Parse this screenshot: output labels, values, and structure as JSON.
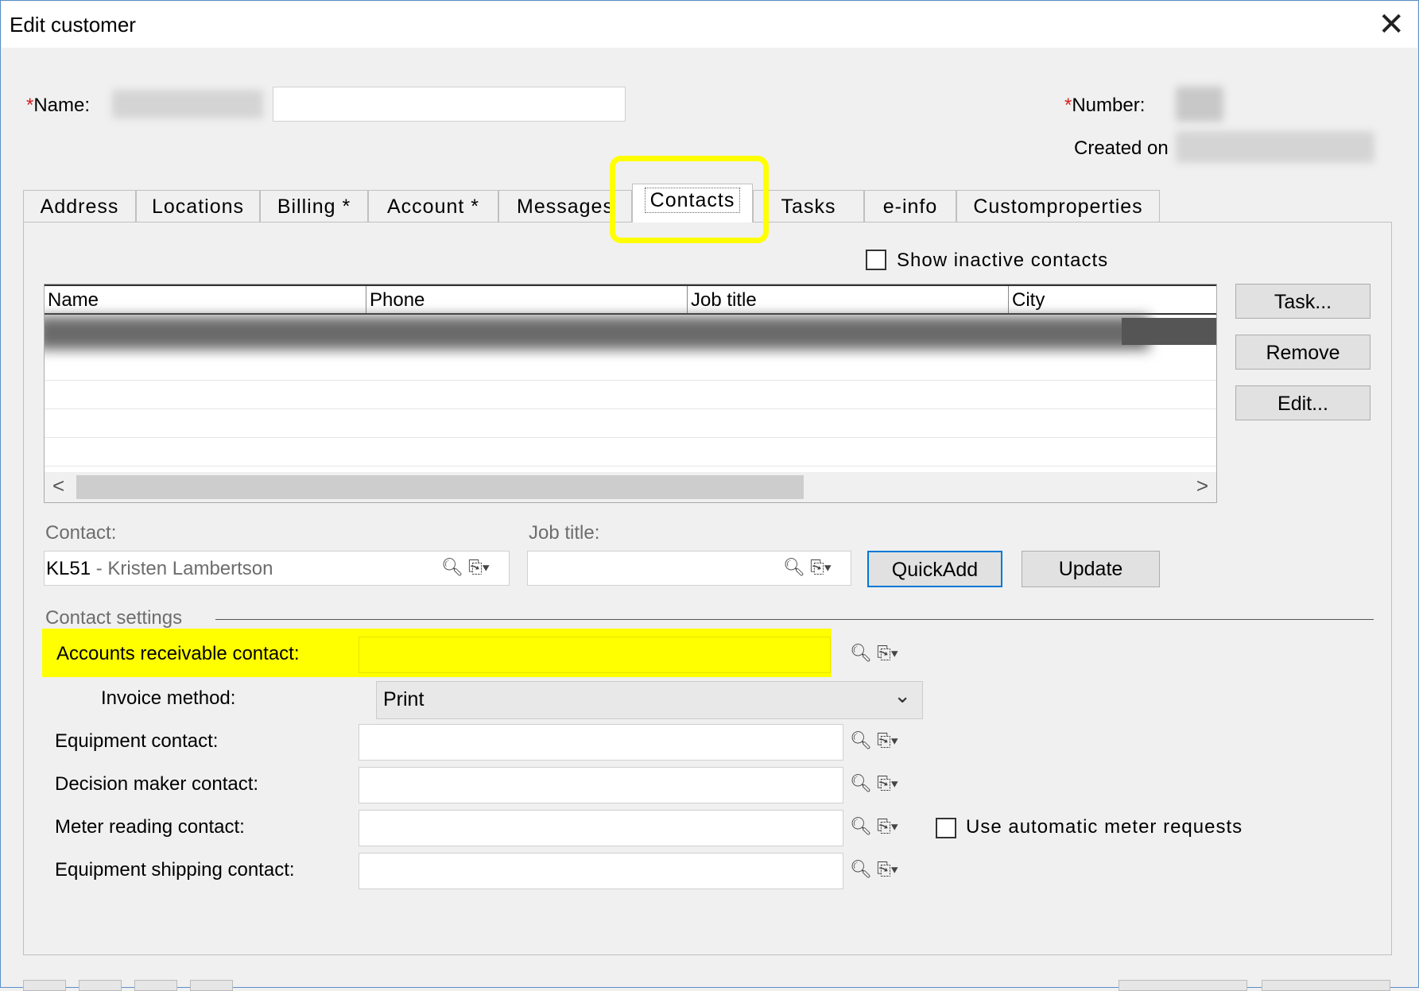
{
  "window": {
    "title": "Edit customer"
  },
  "header": {
    "name_label": "Name:",
    "name_required": "*",
    "number_label": "Number:",
    "number_required": "*",
    "created_label": "Created on"
  },
  "tabs": [
    {
      "label": "Address"
    },
    {
      "label": "Locations"
    },
    {
      "label": "Billing *"
    },
    {
      "label": "Account *"
    },
    {
      "label": "Messages"
    },
    {
      "label": "Contacts"
    },
    {
      "label": "Tasks"
    },
    {
      "label": "e-info"
    },
    {
      "label": "Customproperties"
    }
  ],
  "active_tab": "Contacts",
  "contacts": {
    "show_inactive_label": "Show inactive contacts",
    "columns": [
      "Name",
      "Phone",
      "Job title",
      "City"
    ],
    "side_buttons": {
      "task": "Task...",
      "remove": "Remove",
      "edit": "Edit..."
    },
    "scroll_left": "<",
    "scroll_right": ">"
  },
  "contact_form": {
    "contact_label": "Contact:",
    "contact_code": "KL51",
    "contact_sep": " - ",
    "contact_name": "Kristen  Lambertson",
    "job_title_label": "Job title:",
    "quickadd": "QuickAdd",
    "update": "Update"
  },
  "settings": {
    "section_label": "Contact settings",
    "ar_contact_label": "Accounts receivable contact:",
    "invoice_method_label": "Invoice method:",
    "invoice_method_value": "Print",
    "equipment_label": "Equipment contact:",
    "decision_label": "Decision maker contact:",
    "meter_label": "Meter reading contact:",
    "auto_meter_label": "Use automatic meter requests",
    "shipping_label": "Equipment shipping contact:"
  },
  "colors": {
    "highlight": "#ffff00",
    "accent": "#0078d7",
    "required": "#d02020"
  }
}
